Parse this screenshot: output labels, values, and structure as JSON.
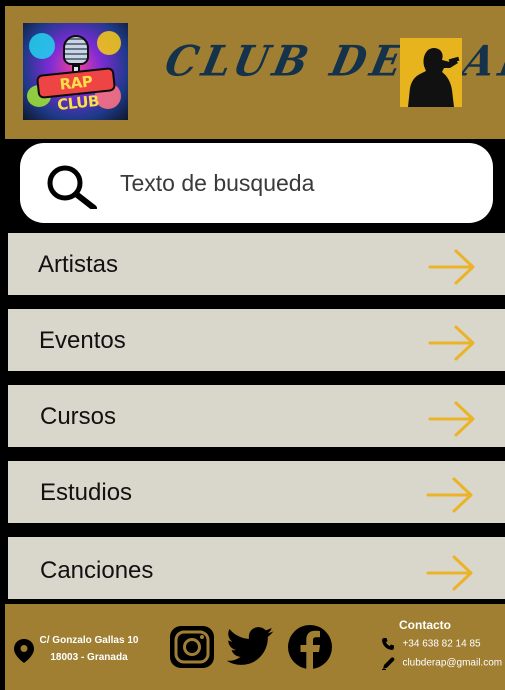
{
  "header": {
    "logo_text": "RAP CLUB",
    "title": "CLUB DE RAP"
  },
  "search": {
    "placeholder": "Texto de busqueda"
  },
  "menu": {
    "items": [
      {
        "label": "Artistas"
      },
      {
        "label": "Eventos"
      },
      {
        "label": "Cursos"
      },
      {
        "label": "Estudios"
      },
      {
        "label": "Canciones"
      }
    ]
  },
  "footer": {
    "address_line1": "C/ Gonzalo Gallas 10",
    "address_line2": "18003 - Granada",
    "contact_title": "Contacto",
    "phone": "+34 638 82 14 85",
    "email": "clubderap@gmail.com"
  },
  "colors": {
    "header_bg": "#a07f33",
    "menu_bg": "#d9d6cb",
    "arrow": "#ebb428",
    "rapper_bg": "#e7b41e"
  },
  "icons": [
    "search-icon",
    "arrow-right-icon",
    "location-pin-icon",
    "instagram-icon",
    "twitter-icon",
    "facebook-icon",
    "phone-icon",
    "pen-icon"
  ]
}
